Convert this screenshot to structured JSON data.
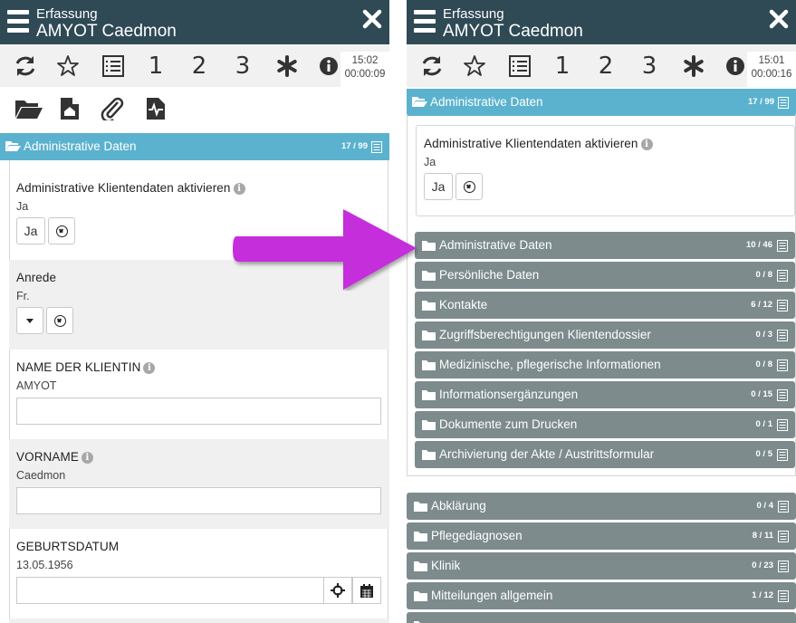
{
  "left": {
    "header": {
      "subtitle": "Erfassung",
      "title": "AMYOT Caedmon"
    },
    "toolbar": {
      "num1": "1",
      "num2": "2",
      "num3": "3",
      "time": "15:02",
      "duration": "00:00:09"
    },
    "section": {
      "label": "Administrative Daten",
      "count": "17 / 99"
    },
    "fields": {
      "activate": {
        "label": "Administrative Klientendaten aktivieren",
        "value": "Ja",
        "button": "Ja"
      },
      "anrede": {
        "label": "Anrede",
        "value": "Fr."
      },
      "name": {
        "label": "NAME DER KLIENTIN",
        "value": "AMYOT",
        "input_value": ""
      },
      "vorname": {
        "label": "VORNAME",
        "value": "Caedmon",
        "input_value": ""
      },
      "geburtsdatum": {
        "label": "GEBURTSDATUM",
        "value": "13.05.1956",
        "input_value": ""
      }
    }
  },
  "right": {
    "header": {
      "subtitle": "Erfassung",
      "title": "AMYOT Caedmon"
    },
    "toolbar": {
      "num1": "1",
      "num2": "2",
      "num3": "3",
      "time": "15:01",
      "duration": "00:00:16"
    },
    "section": {
      "label": "Administrative Daten",
      "count": "17 / 99"
    },
    "activate": {
      "label": "Administrative Klientendaten aktivieren",
      "value": "Ja",
      "button": "Ja"
    },
    "subsections": [
      {
        "label": "Administrative Daten",
        "count": "10 / 46"
      },
      {
        "label": "Persönliche Daten",
        "count": "0 / 8"
      },
      {
        "label": "Kontakte",
        "count": "6 / 12"
      },
      {
        "label": "Zugriffsberechtigungen Klientendossier",
        "count": "0 / 3"
      },
      {
        "label": "Medizinische, pflegerische Informationen",
        "count": "0 / 8"
      },
      {
        "label": "Informationsergänzungen",
        "count": "0 / 15"
      },
      {
        "label": "Dokumente zum Drucken",
        "count": "0 / 1"
      },
      {
        "label": "Archivierung der Akte / Austrittsformular",
        "count": "0 / 5"
      }
    ],
    "sections": [
      {
        "label": "Abklärung",
        "count": "0 / 4"
      },
      {
        "label": "Pflegediagnosen",
        "count": "8 / 11"
      },
      {
        "label": "Klinik",
        "count": "0 / 23"
      },
      {
        "label": "Mitteilungen allgemein",
        "count": "1 / 12"
      },
      {
        "label": "",
        "count": ""
      }
    ]
  },
  "colors": {
    "header": "#2f4a55",
    "section_accent": "#5bb2ce",
    "subsection": "#7d8b8d",
    "arrow": "#c52ddb"
  }
}
